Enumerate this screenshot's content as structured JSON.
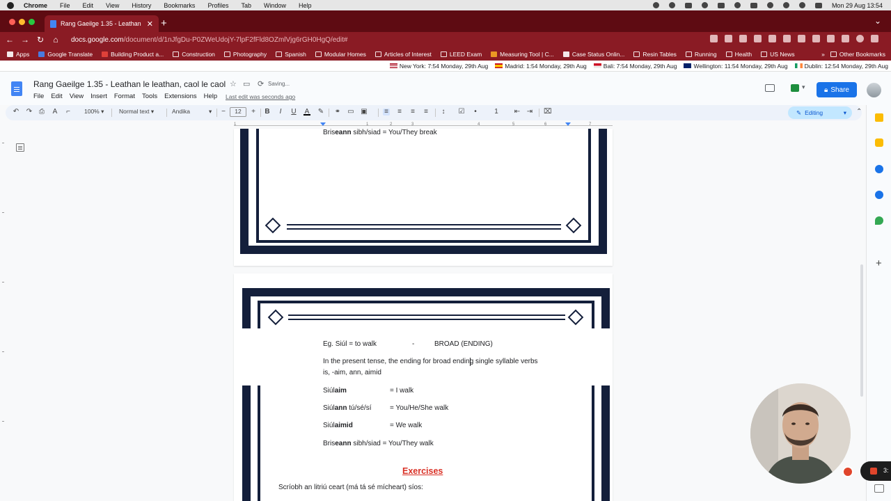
{
  "menubar": {
    "app": "Chrome",
    "items": [
      "File",
      "Edit",
      "View",
      "History",
      "Bookmarks",
      "Profiles",
      "Tab",
      "Window",
      "Help"
    ],
    "datetime": "Mon 29 Aug  13:54"
  },
  "browser": {
    "tab_title": "Rang Gaeilge 1.35 - Leathan",
    "url_host": "docs.google.com",
    "url_path": "/document/d/1nJfgDu-P0ZWeUdojY-7lpF2fFld8OZmlVjg6rGH0HgQ/edit#",
    "bookmarks": [
      "Apps",
      "Google Translate",
      "Building Product a...",
      "Construction",
      "Photography",
      "Spanish",
      "Modular Homes",
      "Articles of Interest",
      "LEED Exam",
      "Measuring Tool | C...",
      "Case Status Onlin...",
      "Resin Tables",
      "Running",
      "Health",
      "US News"
    ],
    "more_chevron": "»",
    "other_bookmarks": "Other Bookmarks"
  },
  "clocks": [
    {
      "label": "New York: 7:54 Monday, 29th Aug",
      "flag": "us"
    },
    {
      "label": "Madrid: 1:54 Monday, 29th Aug",
      "flag": "es"
    },
    {
      "label": "Bali: 7:54 Monday, 29th Aug",
      "flag": "id"
    },
    {
      "label": "Wellington: 11:54 Monday, 29th Aug",
      "flag": "nz"
    },
    {
      "label": "Dublin: 12:54 Monday, 29th Aug",
      "flag": "ie"
    }
  ],
  "docs": {
    "title": "Rang Gaeilge 1.35 - Leathan le leathan, caol le caol",
    "saving": "Saving...",
    "menus": [
      "File",
      "Edit",
      "View",
      "Insert",
      "Format",
      "Tools",
      "Extensions",
      "Help"
    ],
    "last_edit": "Last edit was seconds ago",
    "share": "Share"
  },
  "toolbar": {
    "zoom": "100%",
    "style": "Normal text",
    "font": "Andika",
    "font_size": "12",
    "mode": "Editing"
  },
  "ruler": {
    "ticks": [
      "1",
      "1",
      "2",
      "3",
      "4",
      "5",
      "6",
      "7"
    ]
  },
  "page1": {
    "line_prefix": "Bris",
    "line_bold": "eann",
    "line_rest": " sibh/siad = You/They break"
  },
  "page2": {
    "example": "Eg. Siúl = to walk",
    "dash": "-",
    "broad": "BROAD (ENDING)",
    "rule_line1": "In the present tense, the ending for broad ending single syllable verbs",
    "rule_line2": "is, -aim, ann, aimid",
    "conj": [
      {
        "stem": "Siúl",
        "ending": "aim",
        "rest": "",
        "eq": "= I walk"
      },
      {
        "stem": "Siúl",
        "ending": "ann",
        "rest": " tú/sé/sí",
        "eq": "= You/He/She walk"
      },
      {
        "stem": "Siúl",
        "ending": "aimid",
        "rest": "",
        "eq": "= We walk"
      },
      {
        "stem": "Bris",
        "ending": "eann",
        "rest": " sibh/siad",
        "eq": "= You/They walk"
      }
    ],
    "exercises": "Exercises",
    "instruction": "Scríobh an litriú ceart (má tá sé mícheart) síos:"
  },
  "recording": {
    "timer": "3:"
  },
  "colors": {
    "chrome_dark": "#5e0b12",
    "chrome_accent": "#8a1b24",
    "frame_navy": "#141f3b",
    "share_blue": "#1a73e8",
    "exercises_red": "#d93025"
  }
}
